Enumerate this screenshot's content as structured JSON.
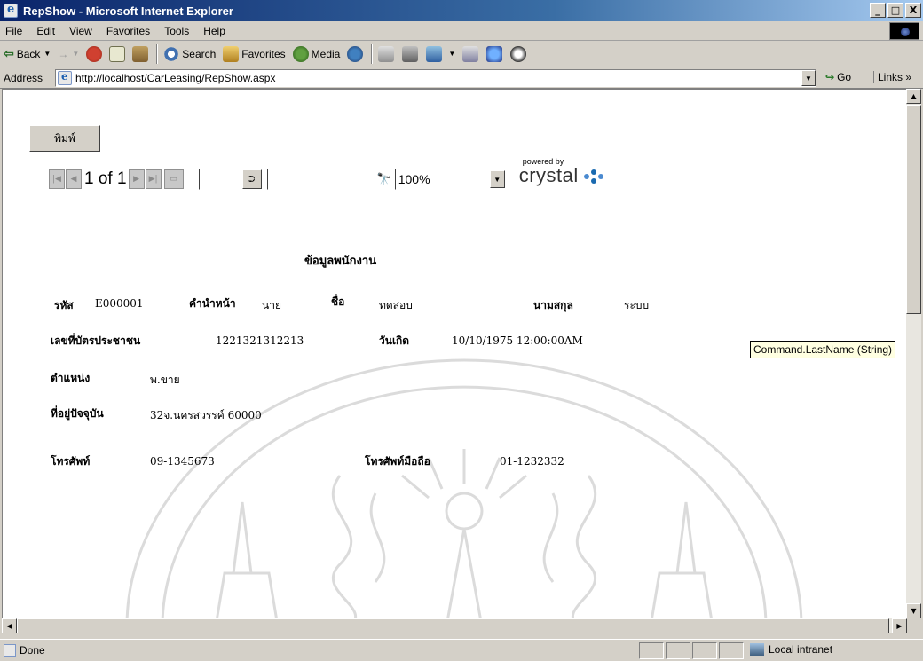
{
  "window": {
    "title": "RepShow - Microsoft Internet Explorer",
    "buttons": {
      "minimize": "_",
      "maximize": "□",
      "close": "X"
    }
  },
  "menu": [
    "File",
    "Edit",
    "View",
    "Favorites",
    "Tools",
    "Help"
  ],
  "toolbar": {
    "back": "Back",
    "search": "Search",
    "favorites": "Favorites",
    "media": "Media"
  },
  "address": {
    "label": "Address",
    "url": "http://localhost/CarLeasing/RepShow.aspx",
    "go": "Go",
    "links": "Links »"
  },
  "viewer": {
    "print_label": "พิมพ์",
    "page_indicator": "1 of 1",
    "goto_page_value": "",
    "search_value": "",
    "zoom": "100%",
    "powered_by": "powered by",
    "crystal": "crystal"
  },
  "report": {
    "title": "ข้อมูลพนักงาน",
    "fields": {
      "id_label": "รหัส",
      "id_value": "E000001",
      "prefix_label": "คำนำหน้า",
      "prefix_value": "นาย",
      "name_label": "ชื่อ",
      "name_value": "ทดสอบ",
      "lastname_label": "นามสกุล",
      "lastname_value": "ระบบ",
      "citizen_label": "เลขที่บัตรประชาชน",
      "citizen_value": "1221321312213",
      "birth_label": "วันเกิด",
      "birth_value": "10/10/1975  12:00:00AM",
      "position_label": "ตำแหน่ง",
      "position_value": "พ.ขาย",
      "address_label": "ที่อยู่ปัจจุบัน",
      "address_value": "32จ.นครสวรรค์ 60000",
      "phone_label": "โทรศัพท์",
      "phone_value": "09-1345673",
      "mobile_label": "โทรศัพท์มือถือ",
      "mobile_value": "01-1232332"
    },
    "tooltip": "Command.LastName (String)"
  },
  "status": {
    "text": "Done",
    "zone": "Local intranet"
  },
  "colors": {
    "titlebar_start": "#0a246a",
    "chrome": "#d4d0c8",
    "tooltip_bg": "#ffffe1"
  }
}
